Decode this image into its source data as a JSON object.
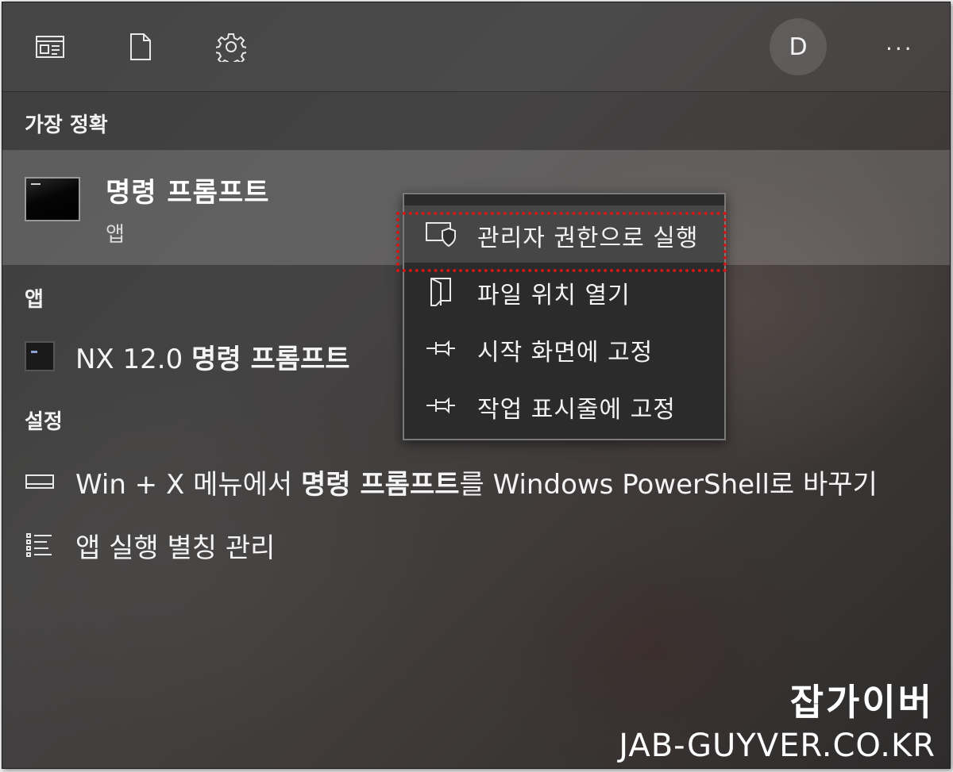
{
  "topbar": {
    "icons": [
      "apps-icon",
      "document-icon",
      "settings-gear-icon"
    ],
    "avatar_initial": "D",
    "more_label": "···"
  },
  "best_match": {
    "section_label": "가장 정확",
    "title": "명령 프롬프트",
    "subtitle": "앱"
  },
  "apps": {
    "section_label": "앱",
    "items": [
      {
        "prefix": "NX 12.0 ",
        "bold": "명령 프롬프트",
        "suffix": ""
      }
    ]
  },
  "settings": {
    "section_label": "설정",
    "items": [
      {
        "prefix": "Win + X 메뉴에서 ",
        "bold": "명령 프롬프트",
        "suffix": "를 Windows PowerShell로 바꾸기",
        "icon": "taskbar-icon"
      },
      {
        "prefix": "앱 실행 별칭 관리",
        "bold": "",
        "suffix": "",
        "icon": "list-icon"
      }
    ]
  },
  "context_menu": {
    "items": [
      {
        "label": "관리자 권한으로 실행",
        "icon": "admin-shield-icon",
        "highlighted": true
      },
      {
        "label": "파일 위치 열기",
        "icon": "folder-open-icon",
        "highlighted": false
      },
      {
        "label": "시작 화면에 고정",
        "icon": "pin-icon",
        "highlighted": false
      },
      {
        "label": "작업 표시줄에 고정",
        "icon": "pin-icon",
        "highlighted": false
      }
    ]
  },
  "watermark": {
    "korean": "잡가이버",
    "site": "JAB-GUYVER.CO.KR"
  },
  "colors": {
    "highlight_box": "#d01818",
    "menu_background": "#2b2b2b"
  }
}
